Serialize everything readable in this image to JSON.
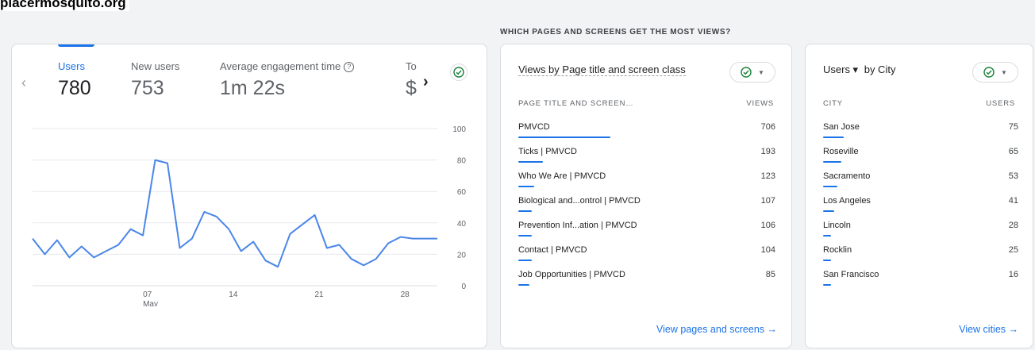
{
  "site": {
    "title": "placermosquito.org"
  },
  "section": {
    "heading": "WHICH PAGES AND SCREENS GET THE MOST VIEWS?"
  },
  "overview": {
    "metrics": [
      {
        "label": "Users",
        "value": "780"
      },
      {
        "label": "New users",
        "value": "753"
      },
      {
        "label": "Average engagement time",
        "value": "1m 22s"
      },
      {
        "label": "To",
        "value": "$"
      }
    ],
    "prev_icon": "chevron-left-icon",
    "next_icon": "chevron-right-icon",
    "check_icon": "check-circle-icon",
    "help_glyph": "?"
  },
  "chart_data": {
    "type": "line",
    "title": "",
    "xlabel": "",
    "ylabel": "",
    "ylim": [
      0,
      100
    ],
    "y_ticks": [
      "100",
      "80",
      "60",
      "40",
      "20",
      "0"
    ],
    "x_ticks": [
      {
        "label": "07",
        "sub": "May",
        "day": 7
      },
      {
        "label": "14",
        "sub": "",
        "day": 14
      },
      {
        "label": "21",
        "sub": "",
        "day": 21
      },
      {
        "label": "28",
        "sub": "",
        "day": 28
      }
    ],
    "grid": true,
    "series": [
      {
        "color": "#4a86e8",
        "x": [
          -2,
          -1,
          0,
          1,
          2,
          3,
          4,
          5,
          6,
          7,
          8,
          9,
          10,
          11,
          12,
          13,
          14,
          15,
          16,
          17,
          18,
          19,
          20,
          21,
          22,
          23,
          24,
          25,
          26,
          27,
          28,
          29,
          30,
          31
        ],
        "values": [
          30,
          20,
          29,
          18,
          25,
          18,
          22,
          26,
          36,
          32,
          80,
          78,
          24,
          30,
          47,
          44,
          36,
          22,
          28,
          16,
          12,
          33,
          39,
          45,
          24,
          26,
          17,
          13,
          17,
          27,
          31,
          30,
          30,
          30
        ]
      }
    ]
  },
  "pages": {
    "title": "Views by Page title and screen class",
    "col_label": "PAGE TITLE AND SCREEN…",
    "col_value": "VIEWS",
    "rows": [
      {
        "label": "PMVCD",
        "value": "706",
        "share": 1.0
      },
      {
        "label": "Ticks | PMVCD",
        "value": "193",
        "share": 0.27
      },
      {
        "label": "Who We Are | PMVCD",
        "value": "123",
        "share": 0.17
      },
      {
        "label": "Biological and...ontrol | PMVCD",
        "value": "107",
        "share": 0.15
      },
      {
        "label": "Prevention Inf...ation | PMVCD",
        "value": "106",
        "share": 0.15
      },
      {
        "label": "Contact | PMVCD",
        "value": "104",
        "share": 0.15
      },
      {
        "label": "Job Opportunities | PMVCD",
        "value": "85",
        "share": 0.12
      }
    ],
    "link": "View pages and screens →"
  },
  "cities": {
    "title_metric": "Users ▾",
    "title_rest": "by City",
    "col_label": "CITY",
    "col_value": "USERS",
    "rows": [
      {
        "label": "San Jose",
        "value": "75",
        "share": 1.0
      },
      {
        "label": "Roseville",
        "value": "65",
        "share": 0.87
      },
      {
        "label": "Sacramento",
        "value": "53",
        "share": 0.71
      },
      {
        "label": "Los Angeles",
        "value": "41",
        "share": 0.55
      },
      {
        "label": "Lincoln",
        "value": "28",
        "share": 0.37
      },
      {
        "label": "Rocklin",
        "value": "25",
        "share": 0.33
      },
      {
        "label": "San Francisco",
        "value": "16",
        "share": 0.21
      }
    ],
    "link": "View cities →"
  },
  "colors": {
    "accent": "#1a73e8",
    "line": "#4a86e8",
    "check": "#188038"
  }
}
